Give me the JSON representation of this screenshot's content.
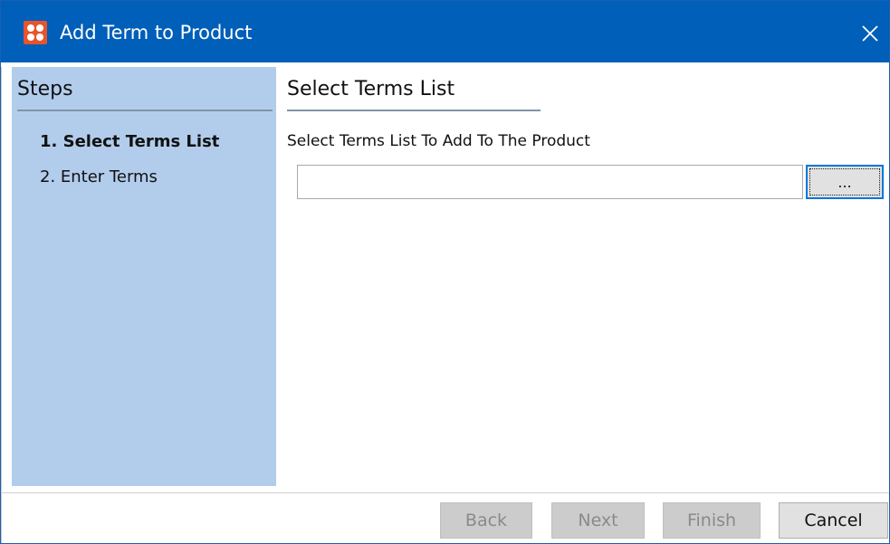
{
  "window": {
    "title": "Add Term to Product"
  },
  "sidebar": {
    "heading": "Steps",
    "steps": [
      {
        "label": "1. Select Terms List",
        "active": true
      },
      {
        "label": "2. Enter Terms",
        "active": false
      }
    ]
  },
  "main": {
    "heading": "Select Terms List",
    "field_label": "Select Terms List To Add To The Product",
    "input_value": "",
    "browse_label": "..."
  },
  "footer": {
    "back_label": "Back",
    "next_label": "Next",
    "finish_label": "Finish",
    "cancel_label": "Cancel"
  },
  "colors": {
    "titlebar": "#005fb8",
    "sidebar": "#b2cdec",
    "app_icon": "#e8542b",
    "focus_border": "#0078d7"
  },
  "icons": {
    "app": "app-logo-icon",
    "close": "close-icon"
  }
}
